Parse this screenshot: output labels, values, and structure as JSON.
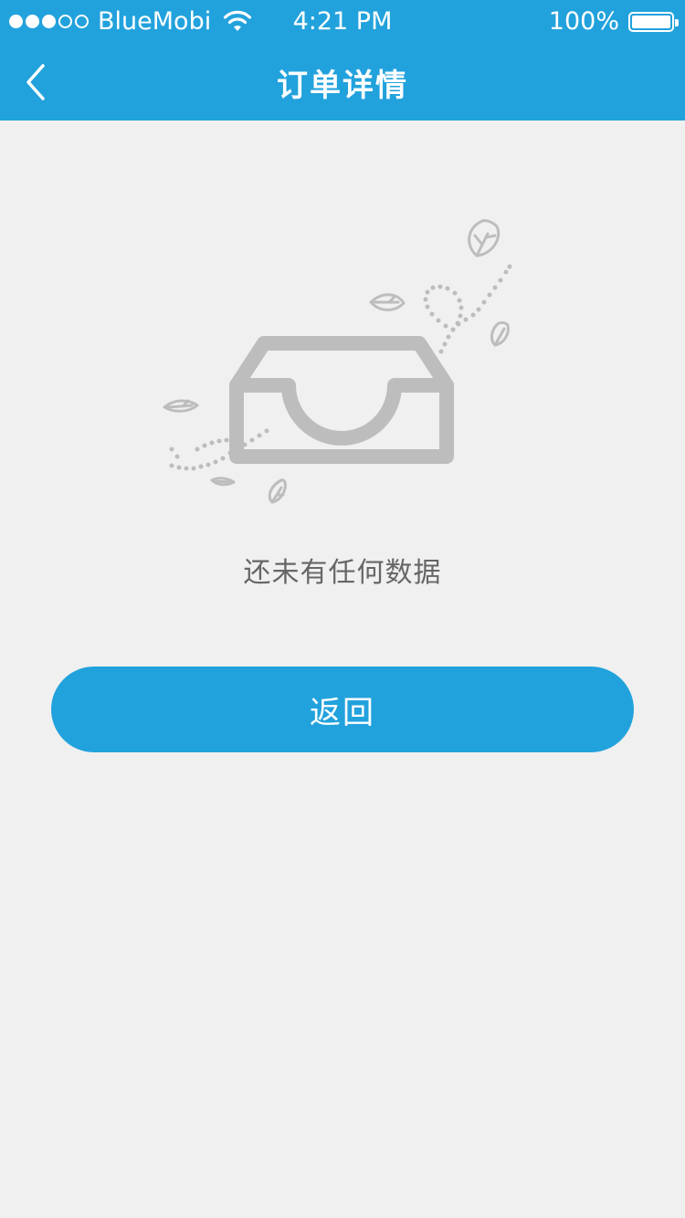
{
  "status_bar": {
    "carrier": "BlueMobi",
    "time": "4:21 PM",
    "battery": "100%",
    "signal_bars_filled": 3,
    "signal_bars_total": 5
  },
  "navbar": {
    "title": "订单详情",
    "back_icon": "chevron-left-icon"
  },
  "empty_state": {
    "illustration_icon": "empty-inbox-icon",
    "message": "还未有任何数据"
  },
  "actions": {
    "return_label": "返回"
  },
  "colors": {
    "accent": "#22a2dc",
    "background": "#f0f0f0",
    "illustration": "#bdbdbd",
    "text_muted": "#666666"
  }
}
